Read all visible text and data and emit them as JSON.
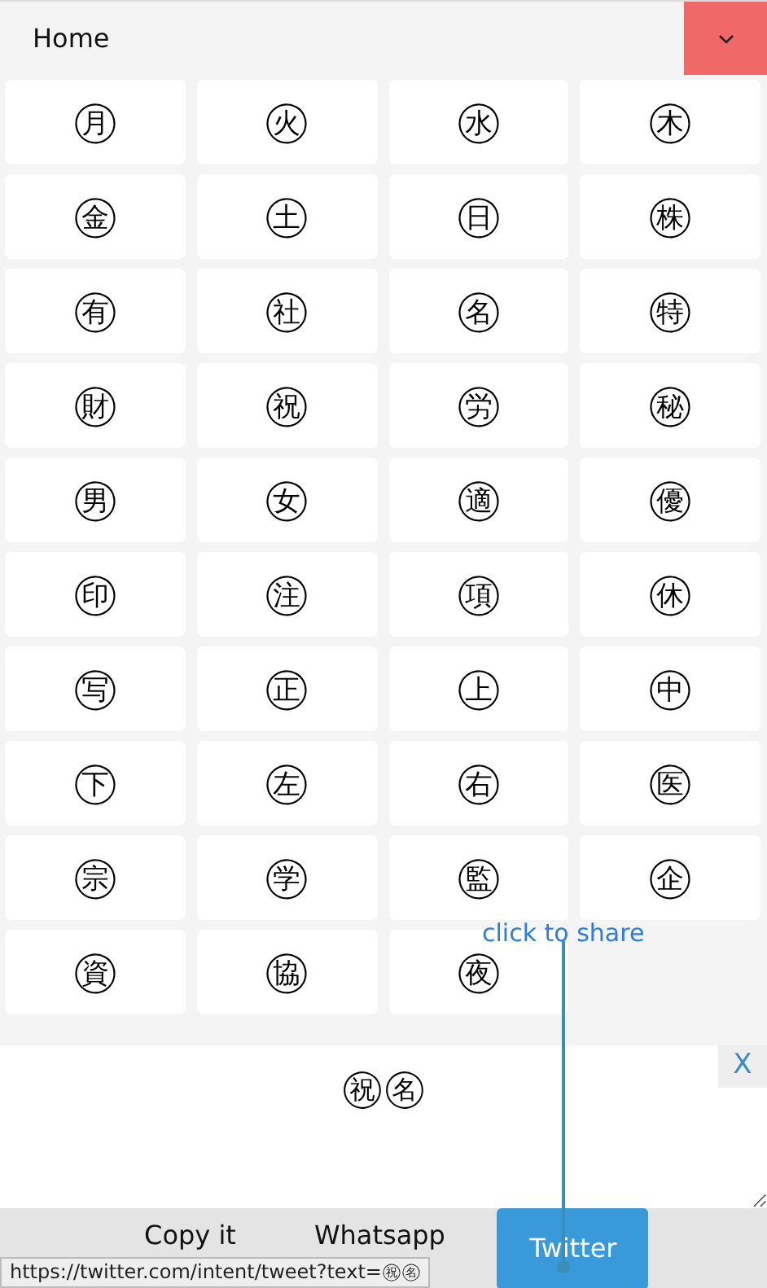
{
  "header": {
    "title": "Home"
  },
  "symbols": [
    "㊊",
    "㊋",
    "㊌",
    "㊍",
    "㊎",
    "㊏",
    "㊐",
    "㊑",
    "㊒",
    "㊓",
    "㊔",
    "㊕",
    "㊖",
    "㊗",
    "㊘",
    "㊙",
    "㊚",
    "㊛",
    "㊜",
    "㊝",
    "㊞",
    "㊟",
    "㊠",
    "㊡",
    "㊢",
    "㊣",
    "㊤",
    "㊥",
    "㊦",
    "㊧",
    "㊨",
    "㊩",
    "㊪",
    "㊫",
    "㊬",
    "㊭",
    "㊮",
    "㊯",
    "㊰"
  ],
  "output": {
    "value": "㊗㊔",
    "close_label": "X"
  },
  "actions": [
    {
      "label": "Copy it",
      "kind": "plain"
    },
    {
      "label": "Whatsapp",
      "kind": "plain"
    },
    {
      "label": "Twitter",
      "kind": "primary"
    }
  ],
  "annotation": {
    "label": "click to share"
  },
  "status_bar": {
    "url": "https://twitter.com/intent/tweet?text=㊗㊔"
  }
}
